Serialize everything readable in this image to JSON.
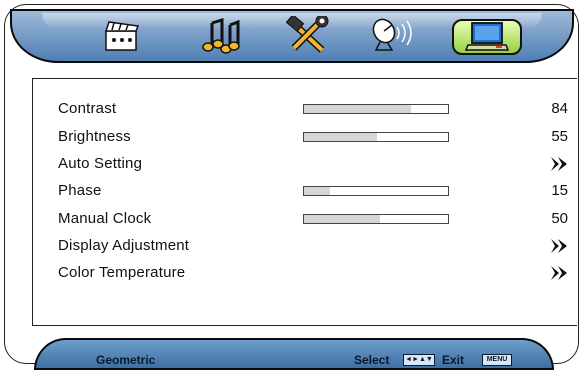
{
  "tabs": [
    {
      "name": "picture-tab",
      "icon": "clapperboard-icon",
      "active": false
    },
    {
      "name": "audio-tab",
      "icon": "music-notes-icon",
      "active": false
    },
    {
      "name": "tools-tab",
      "icon": "hammer-wrench-icon",
      "active": false
    },
    {
      "name": "channel-tab",
      "icon": "satellite-dish-icon",
      "active": false
    },
    {
      "name": "geometric-tab",
      "icon": "monitor-icon",
      "active": true
    }
  ],
  "menu": {
    "contrast": {
      "label": "Contrast",
      "value": "84",
      "level": 0.74
    },
    "brightness": {
      "label": "Brightness",
      "value": "55",
      "level": 0.51
    },
    "auto_setting": {
      "label": "Auto Setting",
      "icon": "arrow-right-icon"
    },
    "phase": {
      "label": "Phase",
      "value": "15",
      "level": 0.18
    },
    "manual_clock": {
      "label": "Manual Clock",
      "value": "50",
      "level": 0.53
    },
    "display_adjustment": {
      "label": "Display Adjustment",
      "icon": "arrow-right-icon"
    },
    "color_temperature": {
      "label": "Color Temperature",
      "icon": "arrow-right-icon"
    }
  },
  "footer": {
    "section": "Geometric",
    "select_label": "Select",
    "select_key": "◄►▲▼",
    "exit_label": "Exit",
    "exit_key": "MENU"
  },
  "colors": {
    "tab_bar": "#6f97c6",
    "active_tab": "#b6e36a",
    "slider_fill": "#d6d6d6"
  }
}
